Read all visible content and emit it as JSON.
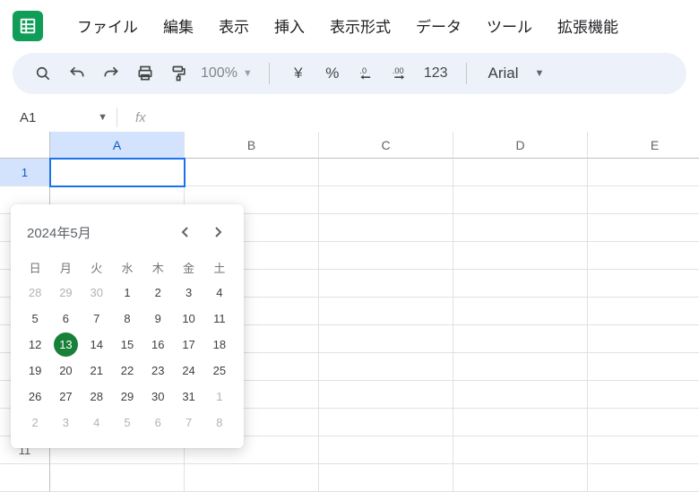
{
  "menus": {
    "file": "ファイル",
    "edit": "編集",
    "view": "表示",
    "insert": "挿入",
    "format": "表示形式",
    "data": "データ",
    "tools": "ツール",
    "extensions": "拡張機能"
  },
  "toolbar": {
    "zoom": "100%",
    "currency_symbol": "¥",
    "percent_symbol": "%",
    "num_format": "123",
    "font": "Arial"
  },
  "namebox": {
    "cell_ref": "A1",
    "fx_label": "fx"
  },
  "columns": [
    "A",
    "B",
    "C",
    "D",
    "E"
  ],
  "rows": [
    "1",
    "11"
  ],
  "datepicker": {
    "title": "2024年5月",
    "dow": [
      "日",
      "月",
      "火",
      "水",
      "木",
      "金",
      "土"
    ],
    "days": [
      {
        "n": "28",
        "out": true
      },
      {
        "n": "29",
        "out": true
      },
      {
        "n": "30",
        "out": true
      },
      {
        "n": "1"
      },
      {
        "n": "2"
      },
      {
        "n": "3"
      },
      {
        "n": "4"
      },
      {
        "n": "5"
      },
      {
        "n": "6"
      },
      {
        "n": "7"
      },
      {
        "n": "8"
      },
      {
        "n": "9"
      },
      {
        "n": "10"
      },
      {
        "n": "11"
      },
      {
        "n": "12"
      },
      {
        "n": "13",
        "sel": true
      },
      {
        "n": "14"
      },
      {
        "n": "15"
      },
      {
        "n": "16"
      },
      {
        "n": "17"
      },
      {
        "n": "18"
      },
      {
        "n": "19"
      },
      {
        "n": "20"
      },
      {
        "n": "21"
      },
      {
        "n": "22"
      },
      {
        "n": "23"
      },
      {
        "n": "24"
      },
      {
        "n": "25"
      },
      {
        "n": "26"
      },
      {
        "n": "27"
      },
      {
        "n": "28"
      },
      {
        "n": "29"
      },
      {
        "n": "30"
      },
      {
        "n": "31"
      },
      {
        "n": "1",
        "out": true
      },
      {
        "n": "2",
        "out": true
      },
      {
        "n": "3",
        "out": true
      },
      {
        "n": "4",
        "out": true
      },
      {
        "n": "5",
        "out": true
      },
      {
        "n": "6",
        "out": true
      },
      {
        "n": "7",
        "out": true
      },
      {
        "n": "8",
        "out": true
      }
    ]
  }
}
